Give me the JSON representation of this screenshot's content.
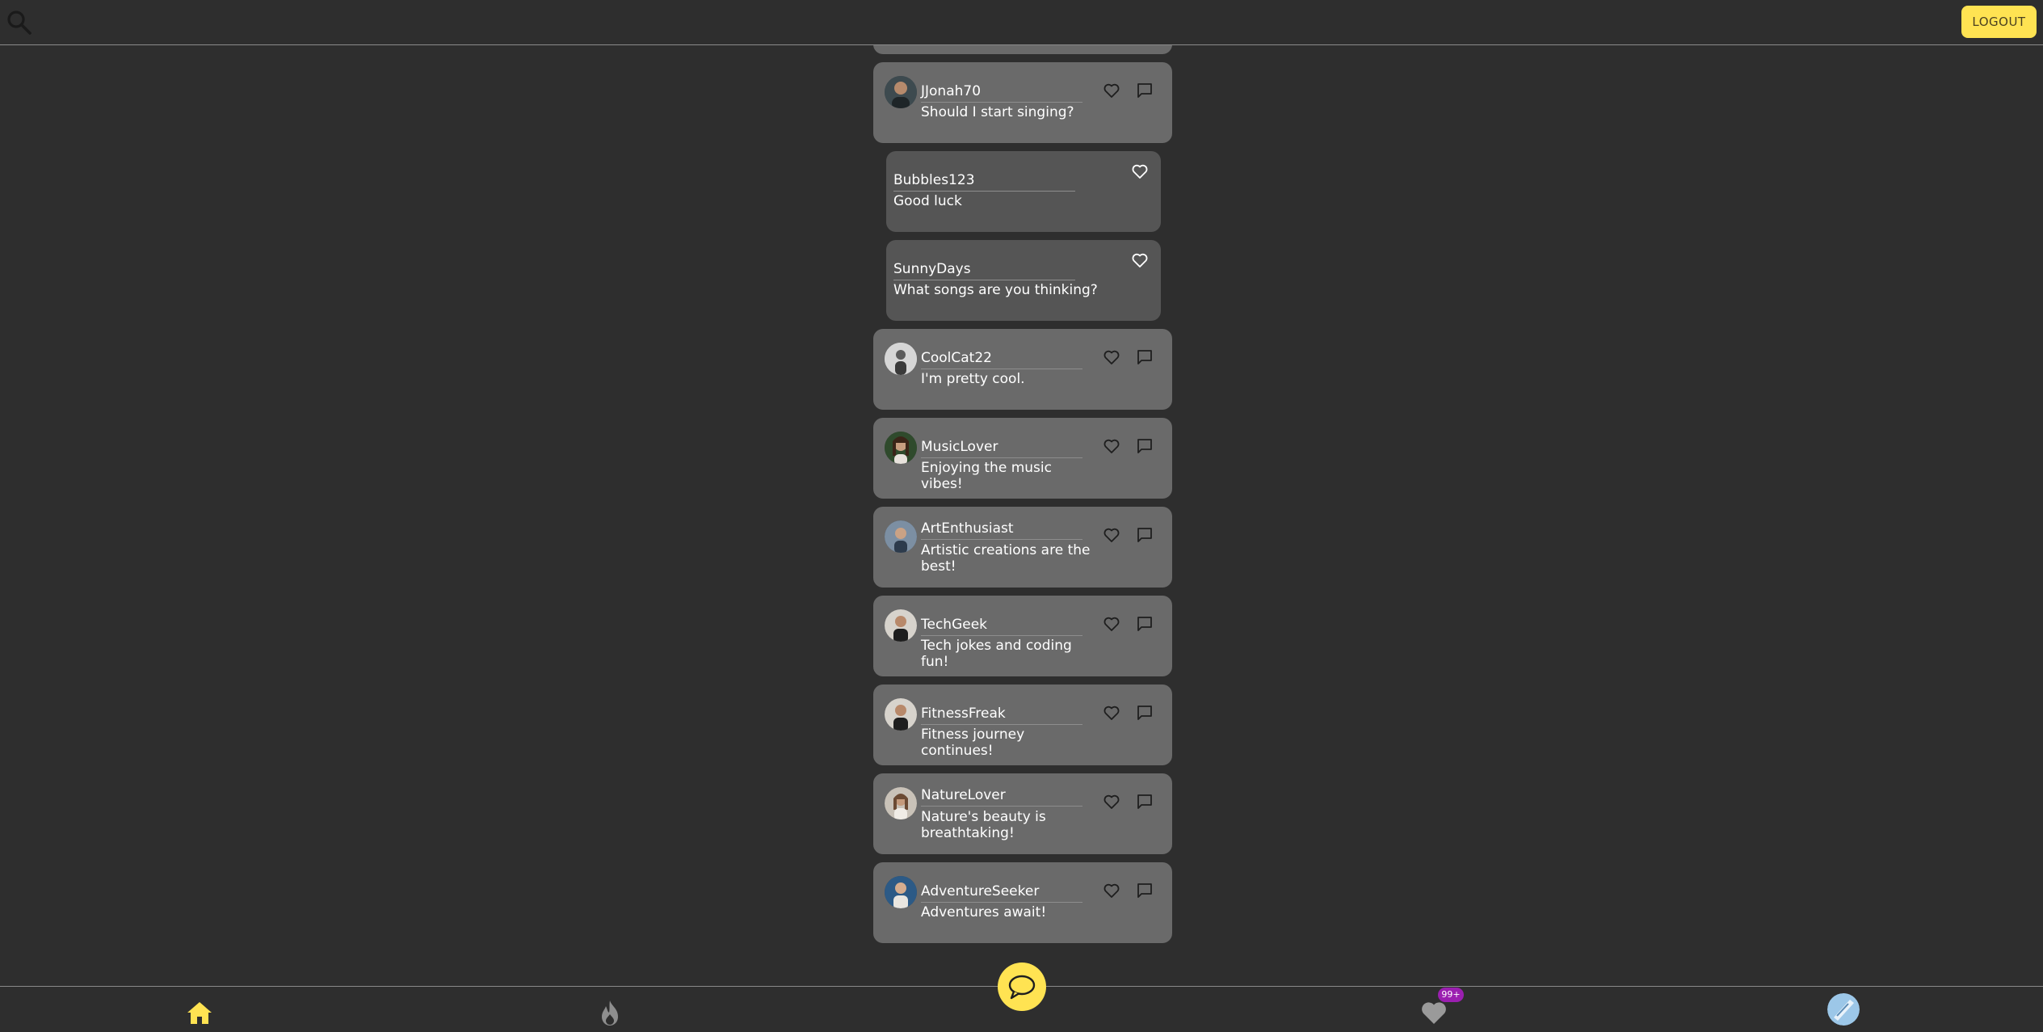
{
  "header": {
    "search_icon": "search-icon",
    "logout_label": "LOGOUT"
  },
  "colors": {
    "background": "#2e2e2e",
    "post_card": "#6a6a6a",
    "reply_card": "#555555",
    "accent": "#ffe352",
    "badge": "#9b1fb0"
  },
  "posts": [
    {
      "type": "post",
      "username": "JJonah70",
      "text": "Should I start singing?"
    },
    {
      "type": "reply",
      "username": "Bubbles123",
      "text": "Good luck"
    },
    {
      "type": "reply",
      "username": "SunnyDays",
      "text": "What songs are you thinking?"
    },
    {
      "type": "post",
      "username": "CoolCat22",
      "text": "I'm pretty cool."
    },
    {
      "type": "post",
      "username": "MusicLover",
      "text": "Enjoying the music vibes!"
    },
    {
      "type": "post",
      "username": "ArtEnthusiast",
      "text": "Artistic creations are the best!"
    },
    {
      "type": "post",
      "username": "TechGeek",
      "text": "Tech jokes and coding fun!"
    },
    {
      "type": "post",
      "username": "FitnessFreak",
      "text": "Fitness journey continues!"
    },
    {
      "type": "post",
      "username": "NatureLover",
      "text": "Nature's beauty is breathtaking!"
    },
    {
      "type": "post",
      "username": "AdventureSeeker",
      "text": "Adventures await!"
    }
  ],
  "bottom_nav": {
    "items": [
      {
        "name": "home-icon",
        "active": true
      },
      {
        "name": "flame-icon",
        "active": false
      },
      {
        "name": "heart-icon",
        "active": false
      },
      {
        "name": "profile-avatar",
        "active": false
      }
    ],
    "new_post_icon": "speech-bubble-icon",
    "notification_badge": "99+"
  }
}
